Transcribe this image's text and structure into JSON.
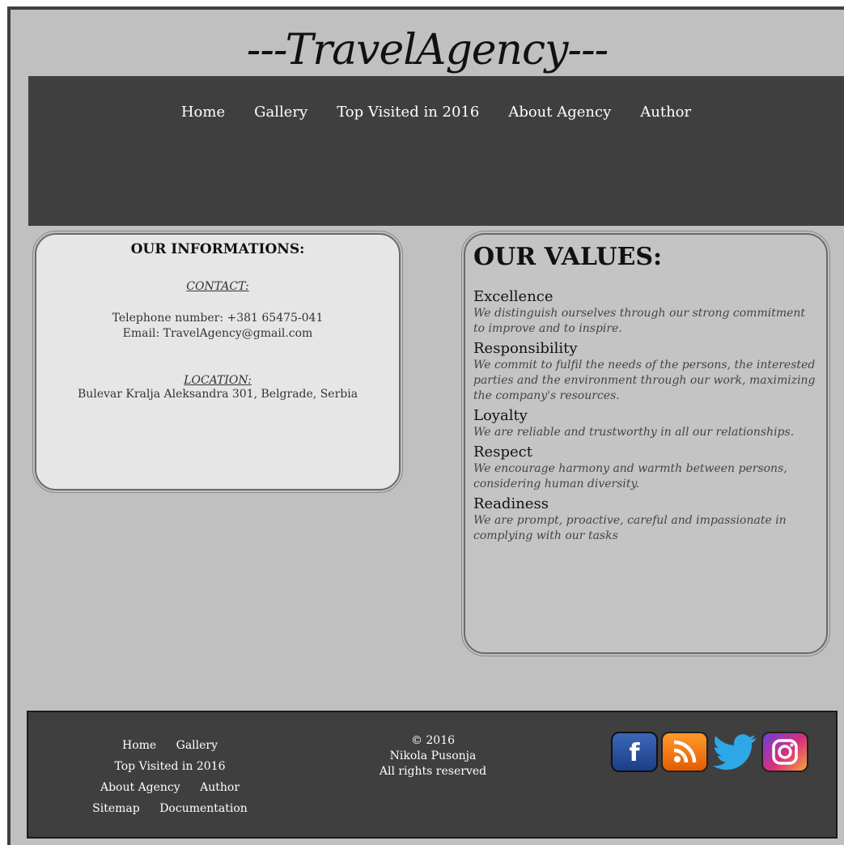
{
  "site": {
    "title": "---TravelAgency---"
  },
  "header_nav": [
    "Home",
    "Gallery",
    "Top Visited in 2016",
    "About Agency",
    "Author"
  ],
  "info": {
    "heading": "OUR INFORMATIONS:",
    "contact_label": "CONTACT:",
    "telephone": "Telephone number: +381 65475-041",
    "email": "Email: TravelAgency@gmail.com",
    "location_label": "LOCATION:",
    "address": "Bulevar Kralja Aleksandra 301, Belgrade, Serbia"
  },
  "values": {
    "heading": "OUR VALUES:",
    "items": [
      {
        "name": "Excellence",
        "desc": "We distinguish ourselves through our strong commitment to improve and to inspire."
      },
      {
        "name": "Responsibility",
        "desc": "We commit to fulfil the needs of the persons, the interested parties and the environment through our work, maximizing the company's resources."
      },
      {
        "name": "Loyalty",
        "desc": "We are reliable and trustworthy in all our relationships."
      },
      {
        "name": "Respect",
        "desc": "We encourage harmony and warmth between persons, considering human diversity."
      },
      {
        "name": "Readiness",
        "desc": "We are prompt, proactive, careful and impassionate in complying with our tasks"
      }
    ]
  },
  "footer": {
    "nav": [
      "Home",
      "Gallery",
      "Top Visited in 2016",
      "About Agency",
      "Author",
      "Sitemap",
      "Documentation"
    ],
    "copyright": "© 2016",
    "owner": "Nikola Pusonja",
    "rights": "All rights reserved",
    "social_icons": [
      "facebook-icon",
      "rss-icon",
      "twitter-icon",
      "instagram-icon"
    ]
  }
}
